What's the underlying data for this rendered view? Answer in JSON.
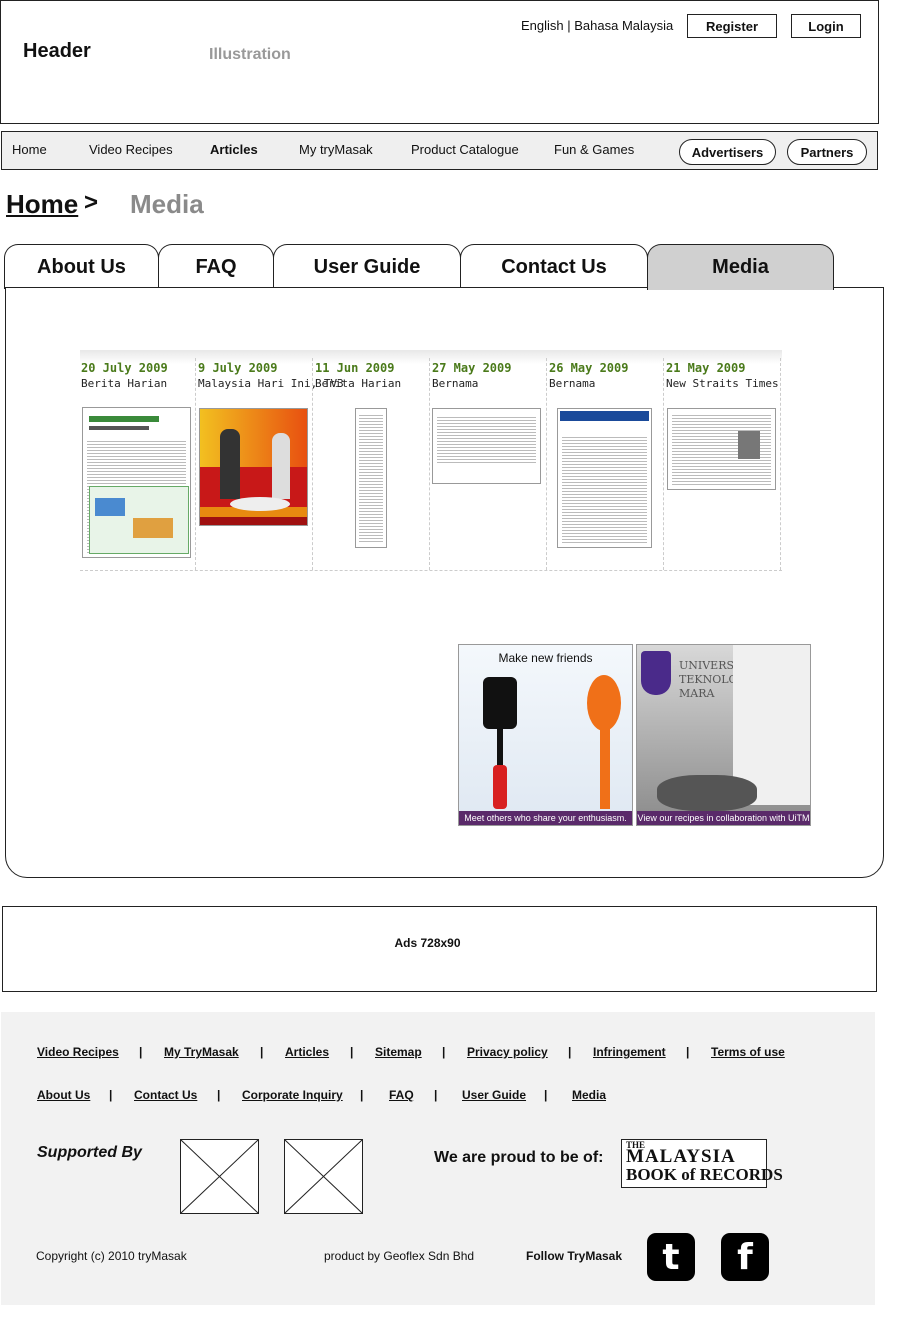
{
  "header": {
    "title": "Header",
    "illustration": "Illustration",
    "languages": "English | Bahasa Malaysia",
    "register_label": "Register",
    "login_label": "Login"
  },
  "nav": {
    "items": [
      "Home",
      "Video Recipes",
      "Articles",
      "My tryMasak",
      "Product Catalogue",
      "Fun & Games"
    ],
    "active": "Articles",
    "advertisers_label": "Advertisers",
    "partners_label": "Partners"
  },
  "breadcrumb": {
    "home": "Home",
    "separator": ">",
    "current": "Media"
  },
  "tabs": [
    "About Us",
    "FAQ",
    "User Guide",
    "Contact Us",
    "Media"
  ],
  "active_tab": "Media",
  "media": [
    {
      "date": "20 July 2009",
      "source": "Berita Harian"
    },
    {
      "date": "9 July 2009",
      "source": "Malaysia Hari Ini, TV3"
    },
    {
      "date": "11 Jun 2009",
      "source": "Berita Harian"
    },
    {
      "date": "27 May 2009",
      "source": "Bernama"
    },
    {
      "date": "26 May 2009",
      "source": "Bernama"
    },
    {
      "date": "21 May 2009",
      "source": "New Straits Times"
    }
  ],
  "promos": [
    {
      "title": "Make new friends",
      "caption": "Meet others who share your enthusiasm."
    },
    {
      "title": "UNIVERSITI TEKNOLOGI MARA",
      "caption": "View our recipes in collaboration with UiTM"
    }
  ],
  "ads": {
    "label": "Ads 728x90"
  },
  "footer": {
    "row1": [
      "Video Recipes",
      "My TryMasak",
      "Articles",
      "Sitemap",
      "Privacy policy",
      "Infringement",
      "Terms of use"
    ],
    "row2": [
      "About Us",
      "Contact Us",
      "Corporate Inquiry",
      "FAQ",
      "User Guide",
      "Media"
    ],
    "separator": "|",
    "supported_by": "Supported By",
    "proud": "We are proud to be of:",
    "record_logo": {
      "line1": "THE",
      "line2": "MALAYSIA",
      "line3": "BOOK of RECORDS"
    },
    "copyright": "Copyright (c) 2010 tryMasak",
    "product_by": "product by Geoflex Sdn Bhd",
    "follow": "Follow TryMasak"
  },
  "icons": {
    "twitter": "twitter-icon",
    "facebook": "facebook-icon"
  },
  "colors": {
    "active_tab": "#d0d0d0",
    "media_date": "#4a7a1a",
    "footer_bg": "#f2f2f2"
  }
}
